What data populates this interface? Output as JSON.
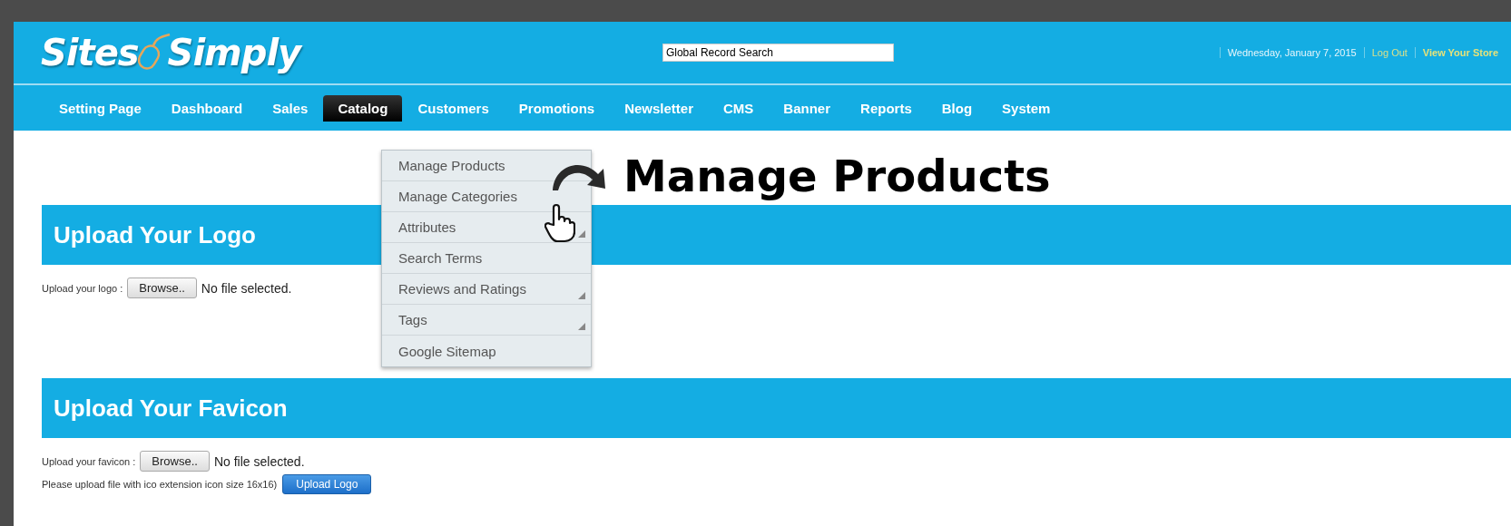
{
  "header": {
    "logo": {
      "left": "Sites",
      "right": "Simply"
    },
    "search": {
      "value": "Global Record Search"
    },
    "date": "Wednesday, January 7, 2015",
    "links": [
      "Log Out",
      "View Your Store"
    ]
  },
  "nav": [
    {
      "label": "Setting Page",
      "selected": false
    },
    {
      "label": "Dashboard",
      "selected": false
    },
    {
      "label": "Sales",
      "selected": false
    },
    {
      "label": "Catalog",
      "selected": true
    },
    {
      "label": "Customers",
      "selected": false
    },
    {
      "label": "Promotions",
      "selected": false
    },
    {
      "label": "Newsletter",
      "selected": false
    },
    {
      "label": "CMS",
      "selected": false
    },
    {
      "label": "Banner",
      "selected": false
    },
    {
      "label": "Reports",
      "selected": false
    },
    {
      "label": "Blog",
      "selected": false
    },
    {
      "label": "System",
      "selected": false
    }
  ],
  "catalog_menu": [
    {
      "label": "Manage Products",
      "has_submenu": false
    },
    {
      "label": "Manage Categories",
      "has_submenu": false
    },
    {
      "label": "Attributes",
      "has_submenu": true
    },
    {
      "label": "Search Terms",
      "has_submenu": false
    },
    {
      "label": "Reviews and Ratings",
      "has_submenu": true
    },
    {
      "label": "Tags",
      "has_submenu": true
    },
    {
      "label": "Google Sitemap",
      "has_submenu": false
    }
  ],
  "callout": "Manage Products",
  "sections": [
    {
      "title": "Upload Your Logo",
      "label": "Upload your logo :",
      "browse": "Browse..",
      "file_status": "No file selected."
    },
    {
      "title": "Upload Your Favicon",
      "label": "Upload your favicon :",
      "browse": "Browse..",
      "file_status": "No file selected.",
      "note": "Please upload file with ico extension icon size 16x16)",
      "submit": "Upload Logo"
    }
  ]
}
